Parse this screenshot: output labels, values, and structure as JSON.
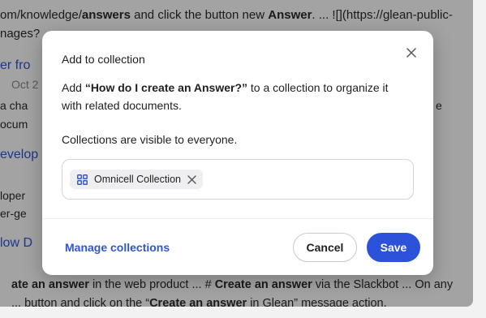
{
  "background": {
    "lines": [
      {
        "prefix": "om/knowledge/",
        "bold1": "answers",
        "mid": " and click the button new ",
        "bold2": "Answer",
        "suffix": ". ... ![](https://glean-public-"
      },
      {
        "text": "nages?"
      },
      {
        "link": "er fro"
      },
      {
        "muted": "Oct 2"
      },
      {
        "text": "a cha"
      },
      {
        "text": "ocum"
      },
      {
        "link": "evelop"
      },
      {
        "text": "loper"
      },
      {
        "text": "er-ge"
      },
      {
        "link": "low D"
      }
    ],
    "right_edge": "e",
    "bottom_line1": {
      "bold1": "ate an answer",
      "mid1": " in the web product ... # ",
      "bold2": "Create an answer",
      "mid2": " via the Slackbot ... On any"
    },
    "bottom_line2": {
      "pre": "... button and click on the “",
      "bold": "Create an answer",
      "post": " in Glean” message action."
    }
  },
  "dialog": {
    "title": "Add to collection",
    "description_prefix": "Add ",
    "question": "“How do I create an Answer?”",
    "description_suffix": " to a collection to organize it with related documents.",
    "visibility_note": "Collections are visible to everyone.",
    "selected_collection": "Omnicell Collection",
    "manage_link": "Manage collections",
    "cancel_label": "Cancel",
    "save_label": "Save"
  },
  "colors": {
    "accent": "#2b52d9",
    "link": "#2f55d4",
    "overlay": "rgba(0,0,0,0.36)"
  },
  "icons": {
    "close": "close-icon",
    "collection": "collection-grid-icon",
    "remove": "remove-chip-icon"
  }
}
